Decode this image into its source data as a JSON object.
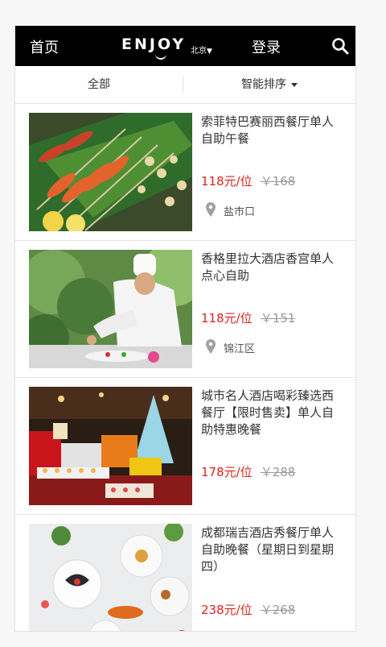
{
  "header": {
    "home_label": "首页",
    "logo_text": "ENJOY",
    "city": "北京",
    "login_label": "登录",
    "search_icon": "search-icon"
  },
  "filters": {
    "all_label": "全部",
    "sort_label": "智能排序"
  },
  "colors": {
    "header_bg": "#000000",
    "price": "#d9251d",
    "original_price": "#999999"
  },
  "items": [
    {
      "title": "索菲特巴赛丽西餐厅单人自助午餐",
      "price": "118元/位",
      "original_price": "￥168",
      "location": "盐市口",
      "image": "seafood-skewers-photo"
    },
    {
      "title": "香格里拉大酒店香宫单人点心自助",
      "price": "118元/位",
      "original_price": "￥151",
      "location": "锦江区",
      "image": "chef-plating-photo"
    },
    {
      "title": "城市名人酒店喝彩臻选西餐厅【限时售卖】单人自助特惠晚餐",
      "price": "178元/位",
      "original_price": "￥288",
      "location": "",
      "image": "buffet-counter-photo"
    },
    {
      "title": "成都瑞吉酒店秀餐厅单人自助晚餐（星期日到星期四）",
      "price": "238元/位",
      "original_price": "￥268",
      "location": "",
      "image": "plated-dishes-photo"
    }
  ]
}
